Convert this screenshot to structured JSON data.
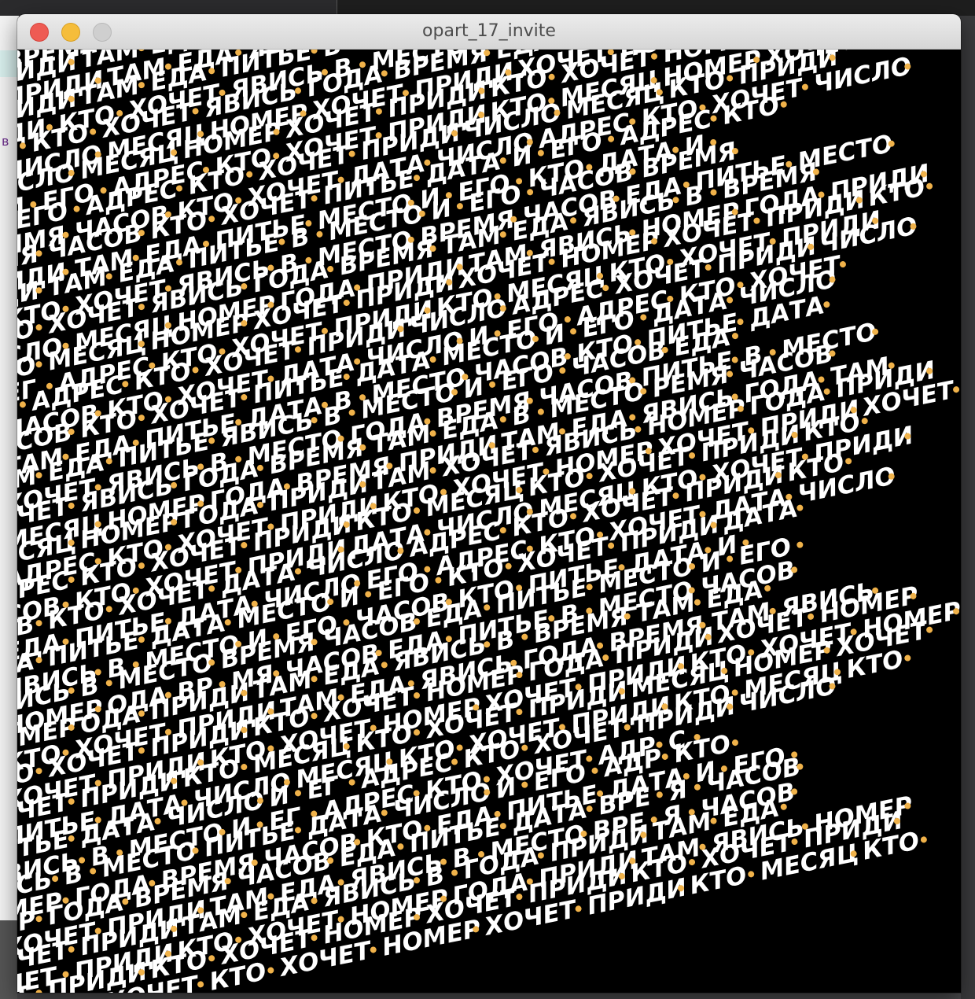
{
  "window": {
    "title": "opart_17_invite"
  },
  "background": {
    "left_letter": "в"
  },
  "artwork": {
    "text_color": "#ffffff",
    "dot_color": "#f0b24a",
    "background_color": "#000000",
    "rows": [
      [
        "ВРЕМЯ",
        "ЧАСОВ",
        "КТО",
        "ЕДА",
        "ПИТЬ",
        "ДАТА",
        "И",
        "ЕГО",
        "КТО",
        "ХОЧЕТ"
      ],
      [
        "ПРИДИ",
        "ТАМ",
        "ЕДА",
        "ПИТЬ",
        "ДАТА",
        "И",
        "ЕГО",
        "КТО",
        "ХОЧЕТ",
        "ПРИДИ"
      ],
      [
        "ПРИДИ",
        "ТАМ",
        "ЕДА",
        "ЯВИСЬ",
        "В",
        "МЕСТО",
        "ВРЕМЯ",
        "ЧАСОВ",
        "ПИТЬЕ",
        "ДАТА"
      ],
      [
        "ПРИДИ",
        "ТАМ",
        "ЕДА",
        "ПИТЬЕ",
        "В",
        "МЕСТО",
        "ВРЕМЯ",
        "ЧАСОВ",
        "КТО",
        "ХОЧЕТ"
      ],
      [
        "ДИ",
        "КТО",
        "ХОЧЕТ",
        "ЯВИСЬ",
        "В",
        "МЕСТО",
        "ВРЕМЯ",
        "ЧАСОВ",
        "ЕДА",
        "ЯВИСЬ"
      ],
      [
        "ДИ",
        "КТО",
        "ХОЧЕТ",
        "ЯВИСЬ",
        "ГОДА",
        "ВРЕМЯ",
        "ЕДА",
        "ЯВИСЬ",
        "В",
        "МЕСТО"
      ],
      [
        "ЧИСЛО",
        "МЕСЯЦ",
        "НОМЕР",
        "ХОЧЕТ",
        "ПРИДИ",
        "ХОЧЕТ",
        "НОМЕР",
        "ГОДА",
        "ВРЕМЯ",
        "ПРИДИ"
      ],
      [
        "ЧИСЛО",
        "МЕСЯЦ",
        "НОМЕР",
        "ХОЧЕТ",
        "ПРИДИ",
        "КТО",
        "ХОЧЕТ",
        "НОМЕР",
        "ГОДА",
        "КТО"
      ],
      [
        "И",
        "ЕГО",
        "АДРЕС",
        "КТО",
        "ХОЧЕТ",
        "ПРИДИ",
        "КТО",
        "МЕСЯЦ",
        "НОМЕР",
        "ХОЧЕТ"
      ],
      [
        "И",
        "ЕГО",
        "АДРЕС",
        "КТО",
        "ХОЧЕТ",
        "ПРИДИ",
        "ЧИСЛО",
        "МЕСЯЦ",
        "КТО",
        "ПРИДИ"
      ],
      [
        "ЯМЯ",
        "ЧАСОВ",
        "КТО",
        "ХОЧЕТ",
        "ДАТА",
        "ЧИСЛО",
        "АДРЕС",
        "КТО",
        "ХОЧЕТ",
        "ЧИСЛО"
      ],
      [
        "ЯМЯ",
        "ЧАСОВ",
        "КТО",
        "ХОЧЕТ",
        "ПИТЬЕ",
        "ДАТА",
        "И",
        "ЕГО",
        "АДРЕС",
        "КТО"
      ],
      [
        "ИДИ",
        "ТАМ",
        "ЕДА",
        "ПИТЬЕ",
        "МЕСТО",
        "И",
        "ЕГО",
        "КТО",
        "ДАТА",
        "И"
      ],
      [
        "ИДИ",
        "ТАМ",
        "ЕДА",
        "ПИТЬЕ",
        "В",
        "МЕСТО",
        "И",
        "ЕГО",
        "ЧАСОВ",
        "ВРЕМЯ"
      ],
      [
        "КТО",
        "ХОЧЕТ",
        "ЯВИСЬ",
        "В",
        "МЕСТО",
        "ВРЕМЯ",
        "ЧАСОВ",
        "ЕДА",
        "ПИТЬЕ",
        "МЕСТО"
      ],
      [
        "КТО",
        "ХОЧЕТ",
        "ЯВИСЬ",
        "ГОДА",
        "ВРЕМЯ",
        "ТАМ",
        "ЕДА",
        "ЯВИСЬ",
        "В",
        "ВРЕМЯ"
      ],
      [
        "СЛО",
        "МЕСЯЦ",
        "НОМЕР",
        "ГОДА",
        "ПРИДИ",
        "ТАМ",
        "ЯВИСЬ",
        "НОМЕР",
        "ГОДА",
        "ПРИДИ"
      ],
      [
        "СЛО",
        "МЕСЯЦ",
        "НОМЕР",
        "ХОЧЕТ",
        "ПРИДИ",
        "ХОЧЕТ",
        "НОМЕР",
        "ХОЧЕТ",
        "ПРИДИ",
        "КТО"
      ],
      [
        "ЕГ",
        "АДРЕС",
        "КТО",
        "ХОЧЕТ",
        "ПРИДИ",
        "КТО",
        "МЕСЯЦ",
        "КТО",
        "ХОЧЕТ",
        "ПРИДИ"
      ],
      [
        "ЕГ",
        "АДРЕС",
        "КТО",
        "ХОЧЕТ",
        "ПРИДИ",
        "ЧИСЛО",
        "АДРЕС",
        "ХОЧЕТ",
        "ПРИДИ",
        "ЧИСЛО"
      ],
      [
        "ЧАСОВ",
        "КТО",
        "ХОЧЕТ",
        "ДАТА",
        "ЧИСЛО",
        "И",
        "ЕГО",
        "АДРЕС",
        "КТО",
        "ХОЧЕТ"
      ],
      [
        "ЧАСОВ",
        "КТО",
        "ХОЧЕТ",
        "ПИТЬЕ",
        "ДАТА",
        "МЕСТО",
        "И",
        "ЕГО",
        "ДАТА",
        "ЧИСЛО"
      ],
      [
        "ТАМ",
        "ЕДА",
        "ПИТЬЕ",
        "ДАТА",
        "В",
        "МЕСТО",
        "ЧАСОВ",
        "КТО",
        "ПИТЬЕ",
        "ДАТА"
      ],
      [
        "ТАМ",
        "ЕДА",
        "ПИТЬЕ",
        "ЯВИСЬ",
        "В",
        "МЕСТО",
        "И",
        "ЕГО",
        "ЧАСОВ",
        "ЕДА"
      ],
      [
        "ХОЧЕТ",
        "ЯВИСЬ",
        "В",
        "МЕСТО",
        "ГОДА",
        "ВРЕМЯ",
        "ЧАСОВ",
        "ПИТЬЕ",
        "В",
        "МЕСТО"
      ],
      [
        "ХОЧЕТ",
        "ЯВИСЬ",
        "ГОДА",
        "ВРЕМЯ",
        "ТАМ",
        "ЕДА",
        "В",
        "МЕСТО",
        "РЕМЯ",
        "ЧАСОВ"
      ],
      [
        "МЕСЯЦ",
        "НОМЕР",
        "ГОДА",
        "ВРЕМЯ",
        "ПРИДИ",
        "ТАМ",
        "ЕДА",
        "ЯВИСЬ",
        "ГОДА",
        "ТАМ"
      ],
      [
        "МЕСЯЦ",
        "НОМЕР",
        "ГОДА",
        "ПРИДИ",
        "ТАМ",
        "ХОЧЕТ",
        "ЯВИСЬ",
        "НОМЕР",
        "ГОДА",
        "ПРИДИ"
      ],
      [
        "АДРЕС",
        "КТО",
        "ХОЧЕТ",
        "ПРИДИ",
        "КТО",
        "ХОЧЕТ",
        "НОМЕР",
        "ХОЧЕТ",
        "ПРИДИ",
        "ХОЧЕТ"
      ],
      [
        "АДРЕС",
        "КТО",
        "ХОЧЕТ",
        "ПРИДИ",
        "КТО",
        "МЕСЯЦ",
        "КТО",
        "ХОЧЕТ",
        "ПРИДИ",
        "КТО"
      ],
      [
        "СОВ",
        "КТО",
        "ХОЧЕТ",
        "ПРИДИ",
        "ДАТА",
        "ЧИСЛО",
        "МЕСЯЦ",
        "КТО",
        "ХОЧЕТ",
        "ПРИДИ"
      ],
      [
        "СОВ",
        "КТО",
        "ХОЧЕТ",
        "ДАТА",
        "ЧИСЛО",
        "АДРЕС",
        "КТО",
        "ХОЧЕТ",
        "ПРИДИ",
        "КТО"
      ],
      [
        "ЕДА",
        "ПИТЬЕ",
        "ДАТА",
        "ЧИСЛО",
        "ЕГО",
        "АДРЕС",
        "КТО",
        "ХОЧЕТ",
        "ДАТА",
        "ЧИСЛО"
      ],
      [
        "ЕДА",
        "ПИТЬЕ",
        "ДАТА",
        "МЕСТО",
        "И",
        "ЕГО",
        "КТО",
        "ХОЧЕТ",
        "ПРИДИ",
        "ДАТА"
      ],
      [
        "ЯВИСЬ",
        "В",
        "МЕСТО",
        "И",
        "ЕГО",
        "ЧАСОВ",
        "КТО",
        "ПИТЬЕ",
        "ДАТА",
        "И"
      ],
      [
        "ЯВИСЬ",
        "В",
        "МЕСТО",
        "ВРЕМЯ",
        "ЧАСОВ",
        "ЕДА",
        "ПИТЬЕ",
        "МЕСТО",
        "И",
        "ЕГО"
      ],
      [
        "НОМЕР",
        "ОДА",
        "ВР",
        "МЯ",
        "ЧАСОВ",
        "ЕДА",
        "ПИТЬЕ",
        "В",
        "МЕСТО",
        "ЧАСОВ"
      ],
      [
        "НОМЕР",
        "ОДА",
        "ПРИДИ",
        "ТАМ",
        "ЕДА",
        "ЯВИСЬ",
        "В",
        "ВРЕМЯ",
        "ТАМ",
        "ЕДА"
      ],
      [
        "КТО",
        "ХОЧЕТ",
        "ПРИДИ",
        "ТАМ",
        "ЕДА",
        "ЯВИСЬ",
        "ГОДА",
        "ВРЕМЯ",
        "ТАМ",
        "ЯВИСЬ"
      ],
      [
        "КТО",
        "ХОЧЕТ",
        "ПРИДИ",
        "КТО",
        "ХОЧЕТ",
        "НОМЕР",
        "ГОДА",
        "ПРИДИ",
        "ХОЧЕТ",
        "НОМЕР"
      ],
      [
        "ХОЧЕТ",
        "ПРИДИ",
        "КТО",
        "ХОЧЕТ",
        "НОМЕР",
        "ХОЧЕТ",
        "ПРИДИ",
        "КТО",
        "ХОЧЕТ",
        "НОМЕР"
      ],
      [
        "ХОЧЕТ",
        "ПРИДИ",
        "КТО",
        "МЕСЯЦ",
        "КТО",
        "ХОЧЕТ",
        "ПРИДИ",
        "МЕСЯЦ",
        "НОМЕР",
        "ХОЧЕТ"
      ],
      [
        "ПИТЬЕ",
        "ДАТА",
        "ЧИСЛО",
        "МЕСЯЦ",
        "КТО",
        "ХОЧЕТ",
        "ПРИДИ",
        "КТО",
        "МЕСЯЦ",
        "КТО"
      ],
      [
        "ПИТЬЕ",
        "ДАТА",
        "ЧИСЛО",
        "И",
        "ЕГ",
        "АДРЕС",
        "КТО",
        "ХОЧЕТ",
        "ПРИДИ",
        "ЧИСЛО"
      ],
      [
        "ВИСЬ",
        "В",
        "МЕСТО",
        "И",
        "ЕГ",
        "АДРЕС",
        "КТО",
        "ХОЧЕТ",
        "АДР",
        "С"
      ],
      [
        "ВИСЬ",
        "В",
        "МЕСТО",
        "ПИТЬЕ",
        "ДАТА",
        "ЧИСЛО",
        "И",
        "ЕГО",
        "АДР",
        "КТО"
      ],
      [
        "МЕР",
        "ГОДА",
        "ВРЕМЯ",
        "ЧАСОВ",
        "КТО",
        "ЕДА",
        "ПИТЬЕ",
        "ДАТА",
        "И",
        "ЕГО"
      ],
      [
        "МЕР",
        "ГОДА",
        "ВРЕМЯ",
        "ЧАСОВ",
        "ЕДА",
        "ПИТЬЕ",
        "ДАТА",
        "ВРЕ",
        "Я",
        "ЧАСОВ"
      ],
      [
        "ХОЧЕТ",
        "ПРИДИ",
        "ТАМ",
        "ЕДА",
        "ЯВИСЬ",
        "В",
        "МЕСТО",
        "ВРЕ",
        "Я",
        "ЧАСОВ"
      ],
      [
        "ХОЧЕТ",
        "ПРИДИ",
        "ТАМ",
        "ЕДА",
        "ЯВИСЬ",
        "В",
        "ГОДА",
        "ПРИДИ",
        "ТАМ",
        "ЕДА"
      ],
      [
        "ЧЕТ",
        "ПРИДИ",
        "КТО",
        "ХОЧЕТ",
        "НОМЕР",
        "ГОДА",
        "ПРИДИ",
        "ТАМ",
        "ЯВИСЬ",
        "НОМЕР"
      ],
      [
        "ЧЕТ",
        "ПРИДИ",
        "КТО",
        "ХОЧЕТ",
        "НОМЕР",
        "ХОЧЕТ",
        "ПРИДИ",
        "КТО",
        "ХОЧЕТ",
        "ПРИДИ"
      ],
      [
        "МЕСЯЦ",
        "ХОЧЕТ",
        "КТО",
        "ХОЧЕТ",
        "НОМЕР",
        "ХОЧЕТ",
        "ПРИДИ",
        "КТО",
        "МЕСЯЦ",
        "КТО"
      ]
    ]
  }
}
